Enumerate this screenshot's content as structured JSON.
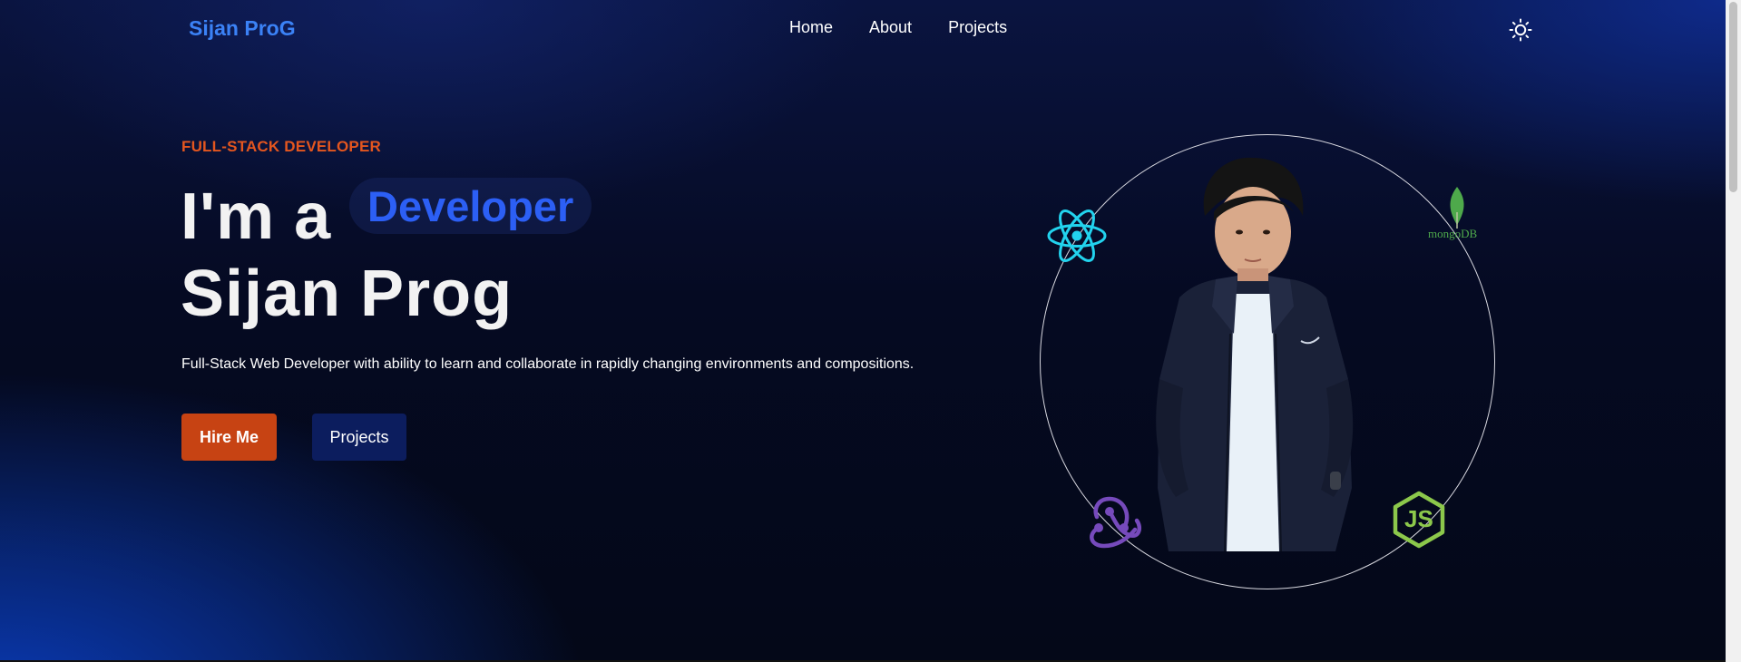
{
  "header": {
    "logo": "Sijan ProG",
    "nav": [
      {
        "label": "Home"
      },
      {
        "label": "About"
      },
      {
        "label": "Projects"
      }
    ],
    "theme_icon": "sun-icon"
  },
  "hero": {
    "eyebrow": "FULL-STACK DEVELOPER",
    "headline_prefix": "I'm a",
    "role": "Developer",
    "name": "Sijan Prog",
    "description": "Full-Stack Web Developer with ability to learn and collaborate in rapidly changing environments and compositions.",
    "hire_button": "Hire Me",
    "projects_button": "Projects"
  },
  "tech": {
    "react": "react-icon",
    "mongodb": "mongoDB",
    "redux": "redux-icon",
    "nodejs": "JS"
  },
  "colors": {
    "accent_blue": "#3b82f6",
    "role_blue": "#2c5ff5",
    "accent_orange": "#c74313",
    "eyebrow_orange": "#e4561f",
    "react": "#22d3ee",
    "mongodb": "#4ea94b",
    "redux": "#764abc",
    "nodejs": "#8cc84b"
  }
}
